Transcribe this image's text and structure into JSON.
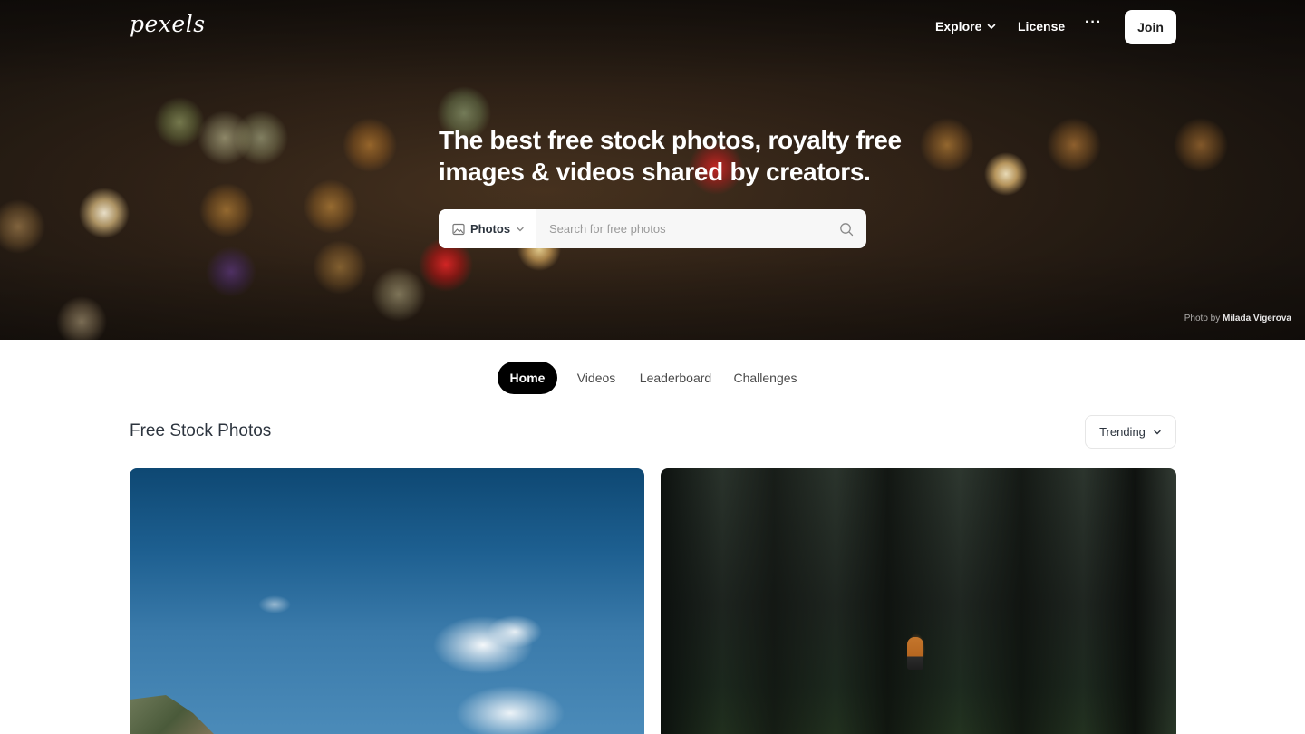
{
  "brand": {
    "logo_text": "pexels"
  },
  "nav": {
    "explore_label": "Explore",
    "license_label": "License",
    "more_label": "···",
    "join_label": "Join"
  },
  "hero": {
    "headline": "The best free stock photos, royalty free images & videos shared by creators.",
    "search": {
      "type_label": "Photos",
      "placeholder": "Search for free photos"
    },
    "credit": {
      "prefix": "Photo by",
      "author": "Milada Vigerova"
    }
  },
  "tabs": [
    {
      "label": "Home",
      "active": true
    },
    {
      "label": "Videos",
      "active": false
    },
    {
      "label": "Leaderboard",
      "active": false
    },
    {
      "label": "Challenges",
      "active": false
    }
  ],
  "section": {
    "title": "Free Stock Photos",
    "sort_label": "Trending"
  },
  "icons": {
    "explore_chevron": "chevron-down-icon",
    "photos_type": "image-icon",
    "type_chevron": "chevron-down-icon",
    "search": "search-icon",
    "sort_chevron": "chevron-down-icon"
  },
  "colors": {
    "accent": "#000000",
    "join_bg": "#ffffff",
    "text": "#2c343e"
  }
}
